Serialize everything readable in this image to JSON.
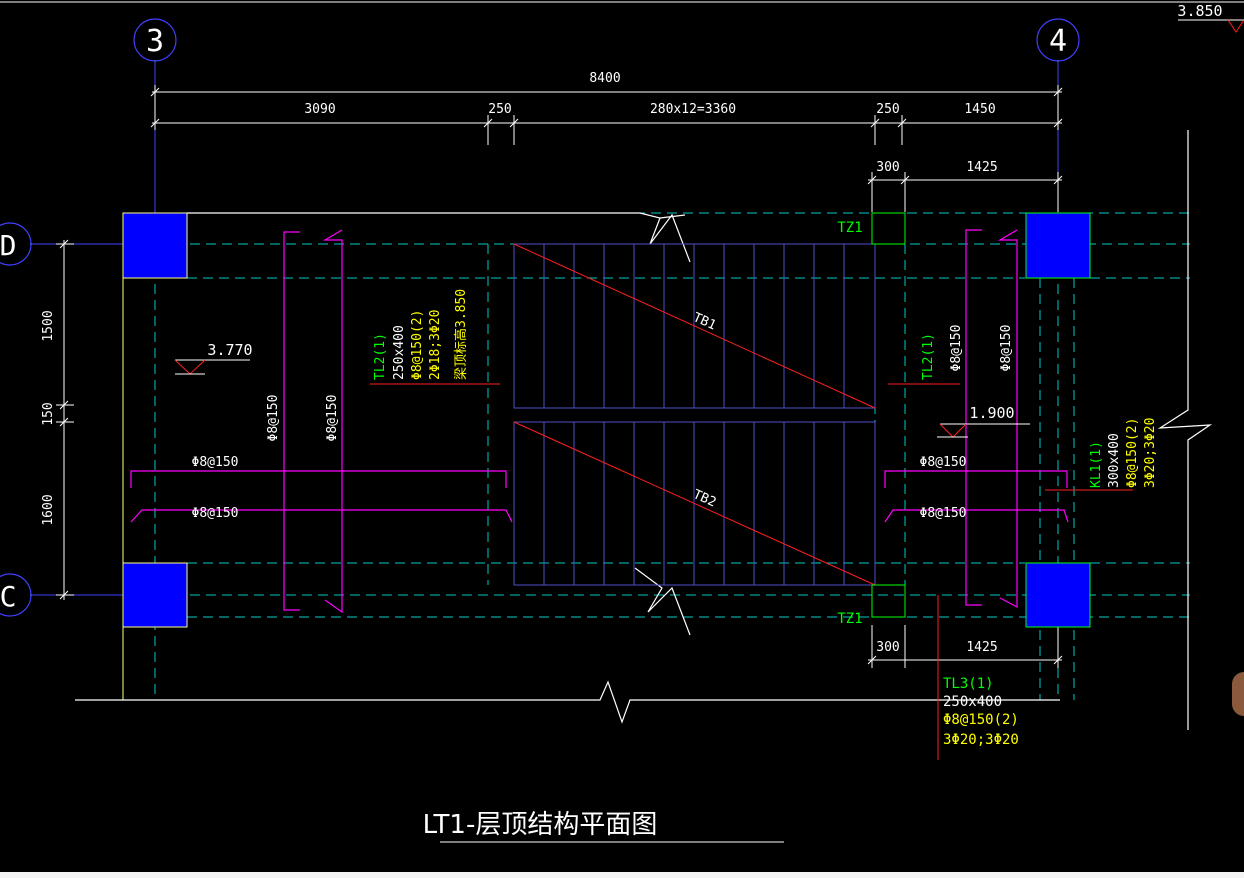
{
  "drawing_title": "LT1-层顶结构平面图",
  "grid_axes": {
    "axis_3": "3",
    "axis_4": "4",
    "axis_D": "D",
    "axis_C": "C"
  },
  "dimensions_top": {
    "overall": "8400",
    "seg1": "3090",
    "seg2": "250",
    "seg3": "280x12=3360",
    "seg4": "250",
    "seg5": "1450"
  },
  "dimensions_right": {
    "a": "300",
    "b": "1425"
  },
  "dimensions_bottom": {
    "a": "300",
    "b": "1425"
  },
  "dimensions_left": {
    "a": "1500",
    "b": "150",
    "c": "1600"
  },
  "elevations": {
    "top_right": "3.850",
    "left": "3.770",
    "right": "1.900"
  },
  "column_labels": {
    "tz1_top": "TZ1",
    "tz1_bottom": "TZ1"
  },
  "stair_labels": {
    "tb1": "TB1",
    "tb2": "TB2"
  },
  "beam_tl2_left": {
    "name": "TL2(1)",
    "size": "250x400",
    "stirrup": "Φ8@150(2)",
    "bars": "2Φ18;3Φ20",
    "note": "梁顶标高3.850"
  },
  "beam_tl2_right": {
    "name": "TL2(1)"
  },
  "beam_kl1": {
    "name": "KL1(1)",
    "size": "300x400",
    "stirrup": "Φ8@150(2)",
    "bars": "3Φ20;3Φ20"
  },
  "beam_tl3": {
    "name": "TL3(1)",
    "size": "250x400",
    "stirrup": "Φ8@150(2)",
    "bars": "3Φ20;3Φ20"
  },
  "rebar_labels": {
    "left_v1": "Φ8@150",
    "left_v2": "Φ8@150",
    "left_h1": "Φ8@150",
    "left_h2": "Φ8@150",
    "right_v1": "Φ8@150",
    "right_v2": "Φ8@150",
    "right_h1": "Φ8@150",
    "right_h2": "Φ8@150"
  },
  "colors": {
    "background": "#000000",
    "column_fill": "#0000ff",
    "grid_line": "#00c8c8",
    "dimension": "#ffffff",
    "rebar": "#ff00ff",
    "label_green": "#00ff00",
    "label_yellow": "#ffff00",
    "stair_line": "#5050c8",
    "red": "#ff0000"
  }
}
